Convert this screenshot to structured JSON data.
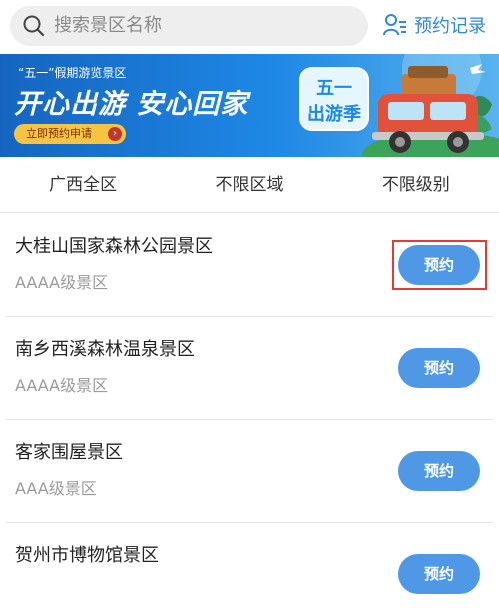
{
  "search": {
    "placeholder": "搜索景区名称"
  },
  "header": {
    "records_label": "预约记录"
  },
  "banner": {
    "subtitle": "“五一”假期游览景区",
    "title": "开心出游 安心回家",
    "button_label": "立即预约申请",
    "badge_line1": "五一",
    "badge_line2": "出游季"
  },
  "filters": [
    {
      "label": "广西全区"
    },
    {
      "label": "不限区域"
    },
    {
      "label": "不限级别"
    }
  ],
  "scenic_spots": [
    {
      "name": "大桂山国家森林公园景区",
      "level": "AAAA级景区",
      "button": "预约"
    },
    {
      "name": "南乡西溪森林温泉景区",
      "level": "AAAA级景区",
      "button": "预约"
    },
    {
      "name": "客家围屋景区",
      "level": "AAA级景区",
      "button": "预约"
    },
    {
      "name": "贺州市博物馆景区",
      "level": "",
      "button": "预约"
    }
  ],
  "colors": {
    "accent": "#2f86e0",
    "button": "#4f98e6",
    "highlight": "#e53935"
  },
  "icons": {
    "search": "search-icon",
    "records": "user-list-icon"
  }
}
